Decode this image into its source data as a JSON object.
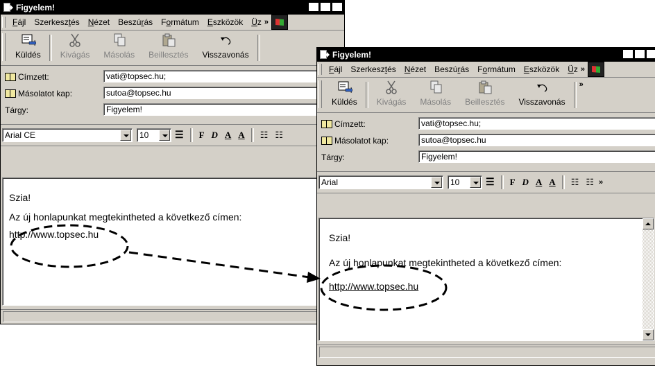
{
  "title": "Figyelem!",
  "title_buttons": {
    "minimize": "_",
    "maximize": "□",
    "close": "×"
  },
  "menu": {
    "items": [
      {
        "pre": "",
        "ul": "F",
        "post": "ájl"
      },
      {
        "pre": "Szerkesz",
        "ul": "t",
        "post": "és"
      },
      {
        "pre": "",
        "ul": "N",
        "post": "ézet"
      },
      {
        "pre": "Beszú",
        "ul": "r",
        "post": "ás"
      },
      {
        "pre": "F",
        "ul": "o",
        "post": "rmátum"
      },
      {
        "pre": "",
        "ul": "E",
        "post": "szközök"
      },
      {
        "pre": "",
        "ul": "Ü",
        "post": "z"
      }
    ],
    "overflow": "»"
  },
  "toolbar": {
    "send": "Küldés",
    "cut": "Kivágás",
    "copy": "Másolás",
    "paste": "Beillesztés",
    "undo": "Visszavonás",
    "overflow": "»"
  },
  "fields": {
    "to_label": "Címzett:",
    "to_value": "vati@topsec.hu;",
    "cc_label": "Másolatot kap:",
    "cc_value": "sutoa@topsec.hu",
    "subject_label": "Tárgy:",
    "subject_value": "Figyelem!"
  },
  "format": {
    "font_left": "Arial CE",
    "font_right": "Arial",
    "size": "10",
    "bold": "F",
    "italic": "D",
    "underline": "A",
    "color": "A",
    "overflow": "»"
  },
  "body": {
    "greeting": "Szia!",
    "line": "Az új honlapunkat megtekintheted a következő címen:",
    "url": "http://www.topsec.hu"
  },
  "colors": {
    "titlebar": "#000000",
    "chrome": "#d4d0c8"
  }
}
